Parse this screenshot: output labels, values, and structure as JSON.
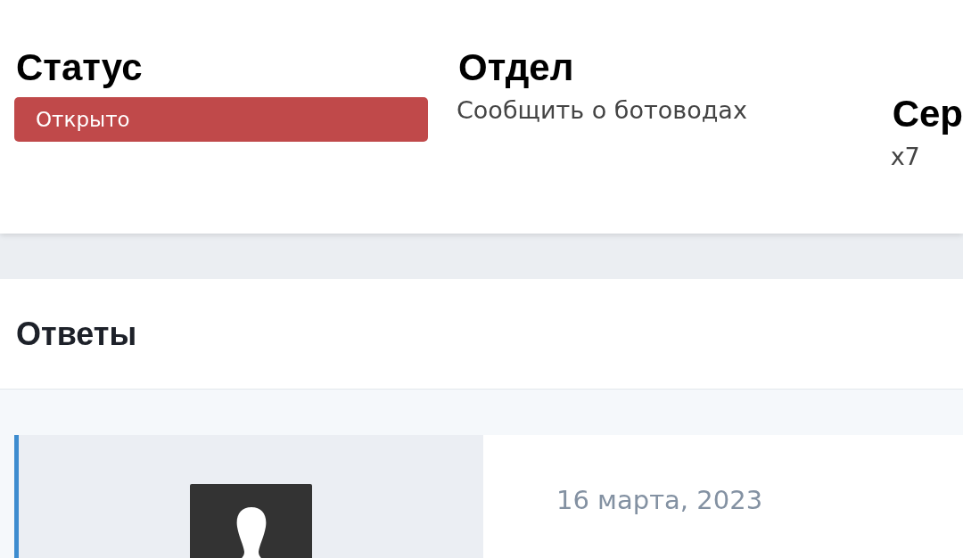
{
  "ticket_info": [
    {
      "kind": "badge",
      "label": "Статус",
      "value": "Открыто",
      "color": "#c0494a"
    },
    {
      "kind": "text",
      "label": "Отдел",
      "value": "Сообщить о ботоводах"
    },
    {
      "kind": "text",
      "label": "Сер",
      "value": "x7"
    }
  ],
  "replies": {
    "title": "Ответы",
    "posts": [
      {
        "date": "16 марта, 2023"
      }
    ]
  }
}
